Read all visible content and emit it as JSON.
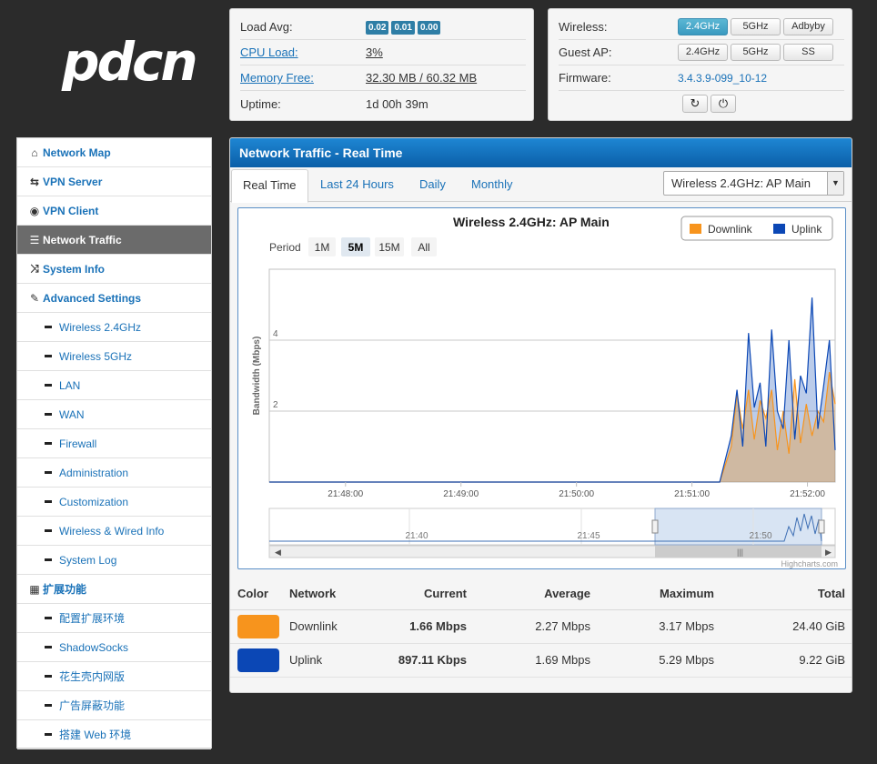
{
  "logo": {
    "text": "pdcn"
  },
  "status": {
    "load_avg_label": "Load Avg:",
    "load_avg": [
      "0.02",
      "0.01",
      "0.00"
    ],
    "cpu_label": "CPU Load:",
    "cpu_value": "3%",
    "mem_label": "Memory Free:",
    "mem_value": "32.30 MB / 60.32 MB",
    "uptime_label": "Uptime:",
    "uptime_value": "1d 00h 39m",
    "wireless_label": "Wireless:",
    "wireless_buttons": [
      "2.4GHz",
      "5GHz",
      "Adbyby"
    ],
    "guest_label": "Guest AP:",
    "guest_buttons": [
      "2.4GHz",
      "5GHz",
      "SS"
    ],
    "firmware_label": "Firmware:",
    "firmware_value": "3.4.3.9-099_10-12",
    "icons": [
      "refresh-icon",
      "power-icon"
    ]
  },
  "sidebar": {
    "items": [
      {
        "label": "Network Map",
        "icon": "home-icon",
        "glyph": "⌂"
      },
      {
        "label": "VPN Server",
        "icon": "retweet-icon",
        "glyph": "⇆"
      },
      {
        "label": "VPN Client",
        "icon": "globe-icon",
        "glyph": "◉"
      },
      {
        "label": "Network Traffic",
        "icon": "list-icon",
        "glyph": "☰",
        "active": true
      },
      {
        "label": "System Info",
        "icon": "random-icon",
        "glyph": "⤨"
      },
      {
        "label": "Advanced Settings",
        "icon": "wrench-icon",
        "glyph": "✎"
      }
    ],
    "advanced_sub": [
      "Wireless 2.4GHz",
      "Wireless 5GHz",
      "LAN",
      "WAN",
      "Firewall",
      "Administration",
      "Customization",
      "Wireless & Wired Info",
      "System Log"
    ],
    "ext_label": "扩展功能",
    "ext_icon": "grid-icon",
    "ext_sub": [
      "配置扩展环境",
      "ShadowSocks",
      "花生壳内网版",
      "广告屏蔽功能",
      "搭建 Web 环境"
    ]
  },
  "main": {
    "title": "Network Traffic - Real Time",
    "tabs": [
      "Real Time",
      "Last 24 Hours",
      "Daily",
      "Monthly"
    ],
    "select_value": "Wireless 2.4GHz: AP Main"
  },
  "chart_data": {
    "type": "area",
    "title": "Wireless 2.4GHz: AP Main",
    "ylabel": "Bandwidth (Mbps)",
    "period_label": "Period",
    "period_buttons": [
      "1M",
      "5M",
      "15M",
      "All"
    ],
    "period_selected": "5M",
    "x_ticks": [
      "21:48:00",
      "21:49:00",
      "21:50:00",
      "21:51:00",
      "21:52:00"
    ],
    "y_ticks": [
      "2",
      "4"
    ],
    "ylim": [
      0,
      6
    ],
    "legend": [
      "Downlink",
      "Uplink"
    ],
    "legend_position": "top-right",
    "navigator_ticks": [
      "21:40",
      "21:45",
      "21:50"
    ],
    "credit": "Highcharts.com",
    "colors": {
      "Downlink": "#f7941d",
      "Uplink": "#0b47b5"
    },
    "x_minutes": [
      0,
      3.9,
      4.0,
      4.05,
      4.1,
      4.15,
      4.2,
      4.25,
      4.3,
      4.35,
      4.4,
      4.45,
      4.5,
      4.55,
      4.6,
      4.65,
      4.7,
      4.75,
      4.8,
      4.85,
      4.9
    ],
    "series": [
      {
        "name": "Downlink",
        "values": [
          0,
          0,
          1.0,
          2.5,
          1.5,
          2.6,
          1.2,
          2.3,
          1.8,
          2.6,
          0.9,
          2.0,
          0.8,
          2.9,
          1.1,
          2.2,
          1.3,
          2.0,
          1.7,
          3.1,
          2.2
        ]
      },
      {
        "name": "Uplink",
        "values": [
          0,
          0,
          1.3,
          2.6,
          1.0,
          4.2,
          2.1,
          2.8,
          1.0,
          4.3,
          2.0,
          1.5,
          4.0,
          1.2,
          3.0,
          2.5,
          5.2,
          1.5,
          2.7,
          4.0,
          0.9
        ]
      }
    ]
  },
  "stats": {
    "headers": [
      "Color",
      "Network",
      "Current",
      "Average",
      "Maximum",
      "Total"
    ],
    "rows": [
      {
        "color": "#f7941d",
        "network": "Downlink",
        "current": "1.66 Mbps",
        "average": "2.27 Mbps",
        "maximum": "3.17 Mbps",
        "total": "24.40 GiB"
      },
      {
        "color": "#0b47b5",
        "network": "Uplink",
        "current": "897.11 Kbps",
        "average": "1.69 Mbps",
        "maximum": "5.29 Mbps",
        "total": "9.22 GiB"
      }
    ]
  }
}
